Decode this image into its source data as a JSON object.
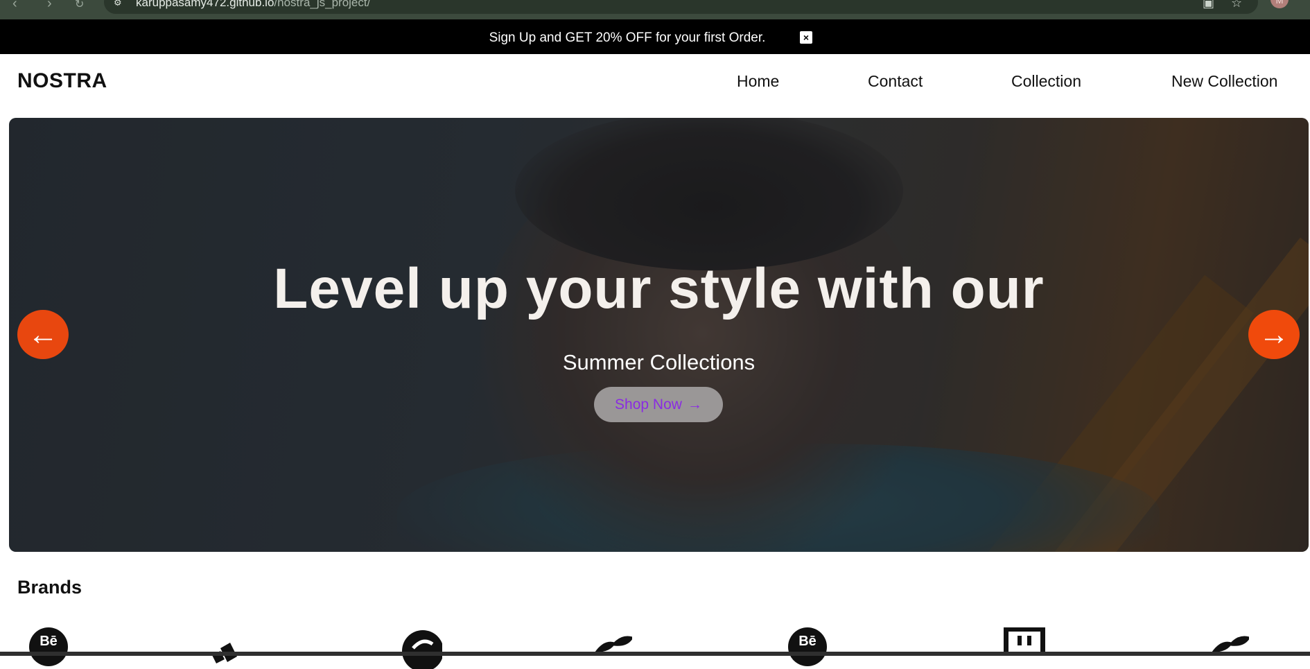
{
  "browser": {
    "url_host": "karuppasamy472.github.io",
    "url_path": "/nostra_js_project/"
  },
  "promo": {
    "text": "Sign Up and GET 20% OFF for your first Order.",
    "close_icon": "×"
  },
  "header": {
    "logo": "NOSTRA",
    "nav": [
      {
        "label": "Home"
      },
      {
        "label": "Contact"
      },
      {
        "label": "Collection"
      },
      {
        "label": "New Collection"
      }
    ]
  },
  "hero": {
    "title": "Level up your style with our",
    "subtitle": "Summer Collections",
    "cta_label": "Shop Now",
    "cta_icon": "→",
    "prev_icon": "←",
    "next_icon": "→",
    "colors": {
      "arrow_bg": "#e8470f",
      "cta_text": "#8a2be2",
      "cta_bg": "#9a9797"
    }
  },
  "brands": {
    "title": "Brands",
    "items": [
      {
        "icon": "behance-icon",
        "glyph": "Bē"
      },
      {
        "icon": "adidas-icon",
        "glyph": ""
      },
      {
        "icon": "skype-icon",
        "glyph": ""
      },
      {
        "icon": "leaf-icon",
        "glyph": ""
      },
      {
        "icon": "behance-icon",
        "glyph": "Bē"
      },
      {
        "icon": "twitch-icon",
        "glyph": ""
      },
      {
        "icon": "leaf-icon",
        "glyph": ""
      }
    ]
  }
}
